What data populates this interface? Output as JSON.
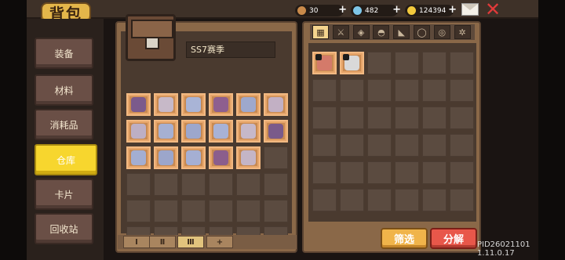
{
  "header": {
    "title": "背包",
    "currencies": [
      {
        "name": "fish",
        "icon": "fish-icon",
        "value": "30"
      },
      {
        "name": "gems",
        "icon": "gem-icon",
        "value": "482"
      },
      {
        "name": "coins",
        "icon": "coin-icon",
        "value": "124394"
      }
    ]
  },
  "sidebar": {
    "items": [
      {
        "label": "装备",
        "active": false
      },
      {
        "label": "材料",
        "active": false
      },
      {
        "label": "消耗品",
        "active": false
      },
      {
        "label": "仓库",
        "active": true
      },
      {
        "label": "卡片",
        "active": false
      },
      {
        "label": "回收站",
        "active": false
      }
    ]
  },
  "storage": {
    "name": "SS7赛季",
    "grid_cols": 6,
    "grid_rows": 6,
    "items": [
      {
        "icon": "helmet-icon",
        "color": "#7b5a8c"
      },
      {
        "icon": "armor-icon",
        "color": "#c7b9c8"
      },
      {
        "icon": "crystal-icon",
        "color": "#a9b4d6"
      },
      {
        "icon": "helmet-icon",
        "color": "#8e5f8f"
      },
      {
        "icon": "crystal-icon",
        "color": "#9ea8cc"
      },
      {
        "icon": "armor-icon",
        "color": "#c2b0c4"
      },
      {
        "icon": "armor-icon",
        "color": "#bdafc4"
      },
      {
        "icon": "crystal-icon",
        "color": "#a6b0d2"
      },
      {
        "icon": "crystal-icon",
        "color": "#9da7cc"
      },
      {
        "icon": "crystal-icon",
        "color": "#a8b2d6"
      },
      {
        "icon": "armor-icon",
        "color": "#c6b8c9"
      },
      {
        "icon": "helmet-icon",
        "color": "#7a5a8a"
      },
      {
        "icon": "crystal-icon",
        "color": "#a3aed2"
      },
      {
        "icon": "crystal-icon",
        "color": "#9ca6cb"
      },
      {
        "icon": "crystal-icon",
        "color": "#a5afd3"
      },
      {
        "icon": "helmet-icon",
        "color": "#8b5e8c"
      },
      {
        "icon": "armor-icon",
        "color": "#c4b5c6"
      }
    ],
    "tabs": [
      "Ⅰ",
      "Ⅱ",
      "Ⅲ",
      "+"
    ],
    "active_tab": 2
  },
  "inventory": {
    "categories": [
      {
        "icon": "grid-icon",
        "active": true
      },
      {
        "icon": "sword-icon",
        "active": false
      },
      {
        "icon": "armor-icon",
        "active": false
      },
      {
        "icon": "helmet-icon",
        "active": false
      },
      {
        "icon": "boots-icon",
        "active": false
      },
      {
        "icon": "ring-icon",
        "active": false
      },
      {
        "icon": "necklace-icon",
        "active": false
      },
      {
        "icon": "gear-icon",
        "active": false
      }
    ],
    "grid_cols": 6,
    "grid_rows": 6,
    "items": [
      {
        "icon": "potion-icon",
        "color": "#d47a6a",
        "locked": true
      },
      {
        "icon": "shield-icon",
        "color": "#d9d9d9",
        "locked": true
      }
    ]
  },
  "actions": {
    "filter_label": "筛选",
    "decompose_label": "分解"
  },
  "footer": {
    "version": "PID26021101 1.11.0.17"
  }
}
